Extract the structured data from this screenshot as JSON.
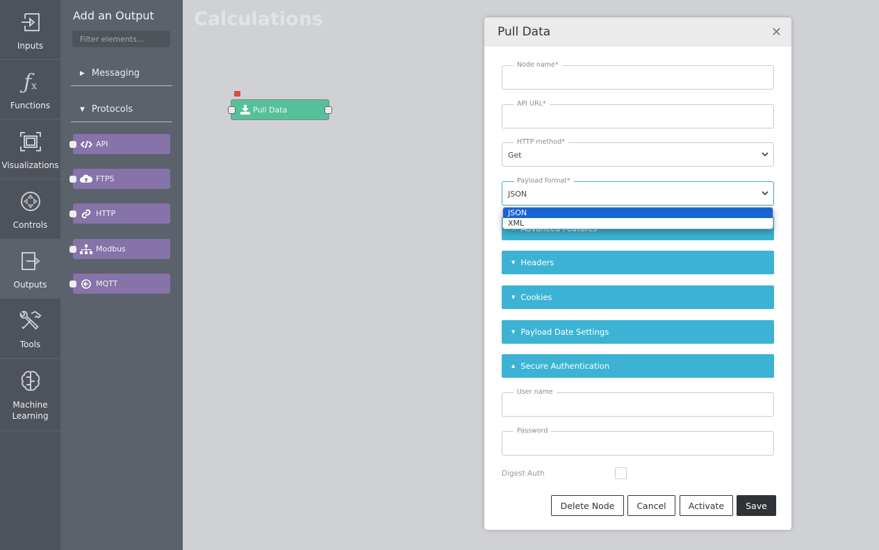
{
  "rail": {
    "items": [
      {
        "label": "Inputs",
        "icon": "input-arrow-icon"
      },
      {
        "label": "Functions",
        "icon": "function-fx-icon"
      },
      {
        "label": "Visualizations",
        "icon": "visualization-frame-icon"
      },
      {
        "label": "Controls",
        "icon": "dpad-control-icon"
      },
      {
        "label": "Outputs",
        "icon": "output-arrow-icon",
        "active": true
      },
      {
        "label": "Tools",
        "icon": "tools-icon"
      },
      {
        "label": "Machine Learning",
        "icon": "brain-icon"
      }
    ]
  },
  "panel": {
    "title": "Add an Output",
    "filter_placeholder": "Filter elements...",
    "categories": [
      {
        "label": "Messaging",
        "expanded": false
      },
      {
        "label": "Protocols",
        "expanded": true
      }
    ],
    "elements": [
      {
        "label": "API",
        "icon": "code-icon"
      },
      {
        "label": "FTPS",
        "icon": "cloud-upload-icon"
      },
      {
        "label": "HTTP",
        "icon": "link-icon"
      },
      {
        "label": "Modbus",
        "icon": "sitemap-icon"
      },
      {
        "label": "MQTT",
        "icon": "circle-arrow-left-icon"
      }
    ]
  },
  "canvas": {
    "title": "Calculations",
    "node": {
      "label": "Pull Data",
      "icon": "download-icon"
    }
  },
  "modal": {
    "title": "Pull Data",
    "fields": {
      "node_name": {
        "label": "Node name*",
        "value": ""
      },
      "api_url": {
        "label": "API URL*",
        "value": ""
      },
      "http_method": {
        "label": "HTTP method*",
        "value": "Get"
      },
      "payload_format": {
        "label": "Payload format*",
        "value": "JSON"
      },
      "user_name": {
        "label": "User name",
        "value": ""
      },
      "password": {
        "label": "Password",
        "value": ""
      }
    },
    "payload_options": [
      "JSON",
      "XML"
    ],
    "payload_selected": "JSON",
    "sections": [
      {
        "label": "Advanced Features",
        "expanded": false
      },
      {
        "label": "Headers",
        "expanded": false
      },
      {
        "label": "Cookies",
        "expanded": false
      },
      {
        "label": "Payload Date Settings",
        "expanded": false
      },
      {
        "label": "Secure Authentication",
        "expanded": true
      }
    ],
    "digest_auth": {
      "label": "Digest Auth",
      "checked": false
    },
    "buttons": {
      "delete": "Delete Node",
      "cancel": "Cancel",
      "activate": "Activate",
      "save": "Save"
    }
  },
  "colors": {
    "accordion": "#3cb3d4",
    "element": "#8573a9",
    "node": "#55c09a",
    "selected_option": "#1a64d2"
  }
}
